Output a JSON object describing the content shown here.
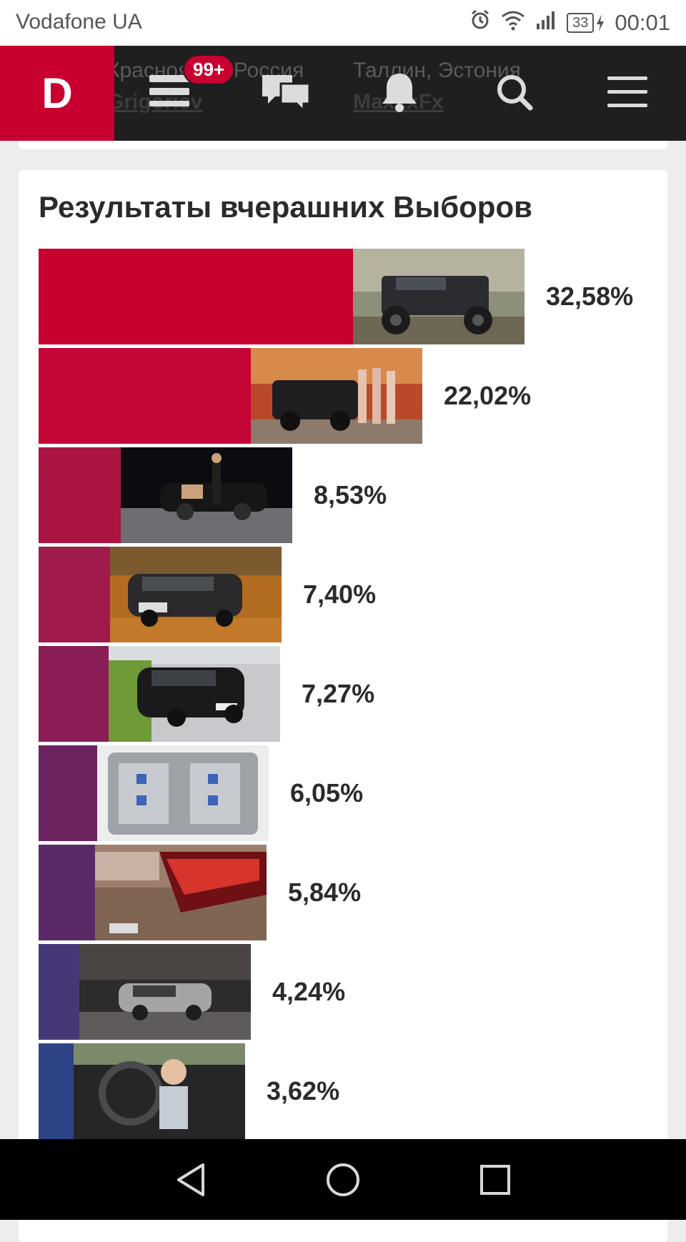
{
  "status_bar": {
    "carrier": "Vodafone UA",
    "battery": "33",
    "time": "00:01"
  },
  "header": {
    "logo": "D",
    "notification_badge": "99+",
    "bg_left_location": "Красноярск, Россия",
    "bg_left_user": "Grigoriev",
    "bg_right_location": "Таллин, Эстония",
    "bg_right_user": "MaxxxFx",
    "icons": [
      "feed-icon",
      "chat-icon",
      "bell-icon",
      "search-icon",
      "menu-icon"
    ]
  },
  "results": {
    "title": "Результаты вчерашних Выборов",
    "items": [
      {
        "percent": "32,58%",
        "value": 32.58,
        "color": "#c8002f",
        "thumb": "black-offroad-suv-photo"
      },
      {
        "percent": "22,02%",
        "value": 22.02,
        "color": "#c40535",
        "thumb": "black-suv-with-models-photo"
      },
      {
        "percent": "8,53%",
        "value": 8.53,
        "color": "#ac1442",
        "thumb": "black-sedan-at-night-photo"
      },
      {
        "percent": "7,40%",
        "value": 7.4,
        "color": "#a01a4b",
        "thumb": "dark-sedan-autumn-photo"
      },
      {
        "percent": "7,27%",
        "value": 7.27,
        "color": "#8a1d55",
        "thumb": "black-sedan-roadside-photo"
      },
      {
        "percent": "6,05%",
        "value": 6.05,
        "color": "#6c2460",
        "thumb": "engine-photo"
      },
      {
        "percent": "5,84%",
        "value": 5.84,
        "color": "#5c2968",
        "thumb": "octavia-taillight-photo"
      },
      {
        "percent": "4,24%",
        "value": 4.24,
        "color": "#463877",
        "thumb": "silver-hatchback-photo"
      },
      {
        "percent": "3,62%",
        "value": 3.62,
        "color": "#2e4487",
        "thumb": "child-in-car-photo"
      }
    ]
  },
  "nav": {
    "buttons": [
      "back-icon",
      "home-icon",
      "recents-icon"
    ]
  }
}
